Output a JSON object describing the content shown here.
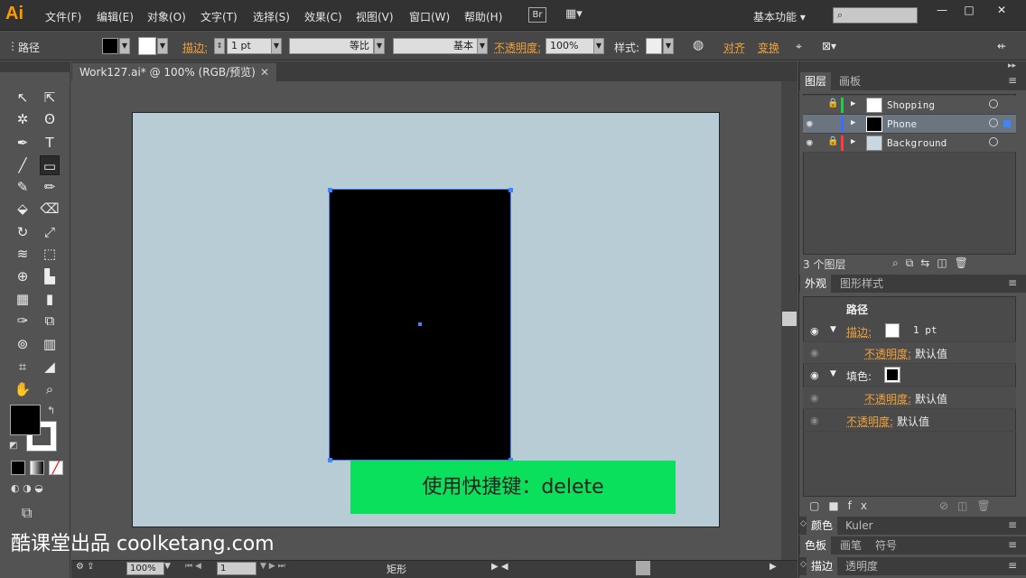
{
  "app": {
    "logo": "Ai"
  },
  "menu": [
    "文件(F)",
    "编辑(E)",
    "对象(O)",
    "文字(T)",
    "选择(S)",
    "效果(C)",
    "视图(V)",
    "窗口(W)",
    "帮助(H)"
  ],
  "bridge_label": "Br",
  "workspace": "基本功能",
  "window_controls": [
    "—",
    "□",
    "✕"
  ],
  "control": {
    "object_type": "路径",
    "stroke_label": "描边:",
    "stroke_weight": "1 pt",
    "profile_label": "等比",
    "brush_label": "基本",
    "opacity_label": "不透明度:",
    "opacity_value": "100%",
    "style_label": "样式:",
    "align_label": "对齐",
    "transform_label": "变换"
  },
  "document": {
    "tab_title": "Work127.ai* @ 100% (RGB/预览)",
    "banner_text": "使用快捷键：delete",
    "watermark": "酷课堂出品 coolketang.com"
  },
  "status": {
    "zoom": "100%",
    "page": "1",
    "tool_name": "矩形"
  },
  "layers_panel": {
    "tabs": [
      "图层",
      "画板"
    ],
    "layers": [
      {
        "name": "Shopping",
        "color": "#22cc44",
        "locked": true,
        "selected": false
      },
      {
        "name": "Phone",
        "color": "#3d6bff",
        "locked": false,
        "selected": true
      },
      {
        "name": "Background",
        "color": "#ff3b3b",
        "locked": true,
        "selected": false
      }
    ],
    "count": "3 个图层"
  },
  "appearance_panel": {
    "tabs": [
      "外观",
      "图形样式"
    ],
    "title": "路径",
    "stroke_label": "描边:",
    "stroke_value": "1 pt",
    "opacity_label": "不透明度:",
    "opacity_value": "默认值",
    "fill_label": "填色:"
  },
  "bottom_panels": [
    {
      "tabs": [
        "颜色",
        "Kuler"
      ]
    },
    {
      "tabs": [
        "色板",
        "画笔",
        "符号"
      ]
    },
    {
      "tabs": [
        "描边",
        "透明度"
      ]
    }
  ]
}
